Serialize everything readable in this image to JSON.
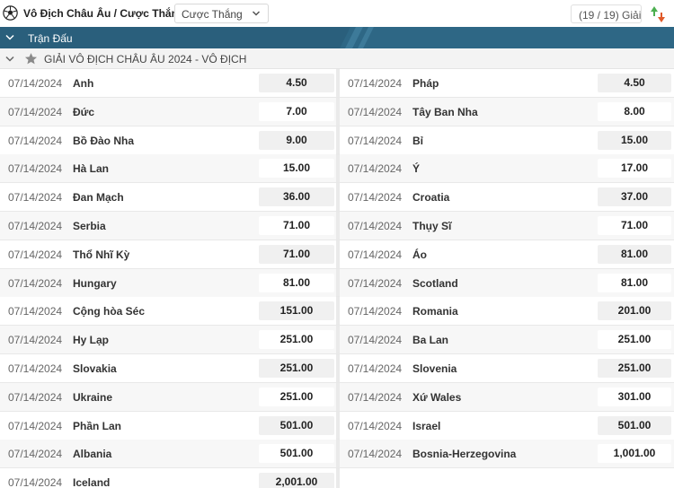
{
  "topbar": {
    "title": "Vô Địch Châu Âu / Cược Thắng",
    "select_value": "Cược Thắng",
    "count": "(19 / 19) Giải"
  },
  "header": {
    "label": "Trận Đấu"
  },
  "league": {
    "label": "GIẢI VÔ ĐỊCH CHÂU ÂU 2024 - VÔ ĐỊCH"
  },
  "colors": {
    "header_bg": "#2e6785",
    "accent_up": "#4caf50",
    "accent_down": "#e05a2a"
  },
  "rows": [
    {
      "left": {
        "date": "07/14/2024",
        "team": "Anh",
        "odd": "4.50"
      },
      "right": {
        "date": "07/14/2024",
        "team": "Pháp",
        "odd": "4.50"
      }
    },
    {
      "left": {
        "date": "07/14/2024",
        "team": "Đức",
        "odd": "7.00"
      },
      "right": {
        "date": "07/14/2024",
        "team": "Tây Ban Nha",
        "odd": "8.00"
      }
    },
    {
      "left": {
        "date": "07/14/2024",
        "team": "Bồ Đào Nha",
        "odd": "9.00"
      },
      "right": {
        "date": "07/14/2024",
        "team": "Bỉ",
        "odd": "15.00"
      }
    },
    {
      "left": {
        "date": "07/14/2024",
        "team": "Hà Lan",
        "odd": "15.00"
      },
      "right": {
        "date": "07/14/2024",
        "team": "Ý",
        "odd": "17.00"
      }
    },
    {
      "left": {
        "date": "07/14/2024",
        "team": "Đan Mạch",
        "odd": "36.00"
      },
      "right": {
        "date": "07/14/2024",
        "team": "Croatia",
        "odd": "37.00"
      }
    },
    {
      "left": {
        "date": "07/14/2024",
        "team": "Serbia",
        "odd": "71.00"
      },
      "right": {
        "date": "07/14/2024",
        "team": "Thụy Sĩ",
        "odd": "71.00"
      }
    },
    {
      "left": {
        "date": "07/14/2024",
        "team": "Thổ Nhĩ Kỳ",
        "odd": "71.00"
      },
      "right": {
        "date": "07/14/2024",
        "team": "Áo",
        "odd": "81.00"
      }
    },
    {
      "left": {
        "date": "07/14/2024",
        "team": "Hungary",
        "odd": "81.00"
      },
      "right": {
        "date": "07/14/2024",
        "team": "Scotland",
        "odd": "81.00"
      }
    },
    {
      "left": {
        "date": "07/14/2024",
        "team": "Cộng hòa Séc",
        "odd": "151.00"
      },
      "right": {
        "date": "07/14/2024",
        "team": "Romania",
        "odd": "201.00"
      }
    },
    {
      "left": {
        "date": "07/14/2024",
        "team": "Hy Lạp",
        "odd": "251.00"
      },
      "right": {
        "date": "07/14/2024",
        "team": "Ba Lan",
        "odd": "251.00"
      }
    },
    {
      "left": {
        "date": "07/14/2024",
        "team": "Slovakia",
        "odd": "251.00"
      },
      "right": {
        "date": "07/14/2024",
        "team": "Slovenia",
        "odd": "251.00"
      }
    },
    {
      "left": {
        "date": "07/14/2024",
        "team": "Ukraine",
        "odd": "251.00"
      },
      "right": {
        "date": "07/14/2024",
        "team": "Xứ Wales",
        "odd": "301.00"
      }
    },
    {
      "left": {
        "date": "07/14/2024",
        "team": "Phần Lan",
        "odd": "501.00"
      },
      "right": {
        "date": "07/14/2024",
        "team": "Israel",
        "odd": "501.00"
      }
    },
    {
      "left": {
        "date": "07/14/2024",
        "team": "Albania",
        "odd": "501.00"
      },
      "right": {
        "date": "07/14/2024",
        "team": "Bosnia-Herzegovina",
        "odd": "1,001.00"
      }
    },
    {
      "left": {
        "date": "07/14/2024",
        "team": "Iceland",
        "odd": "2,001.00"
      }
    }
  ]
}
